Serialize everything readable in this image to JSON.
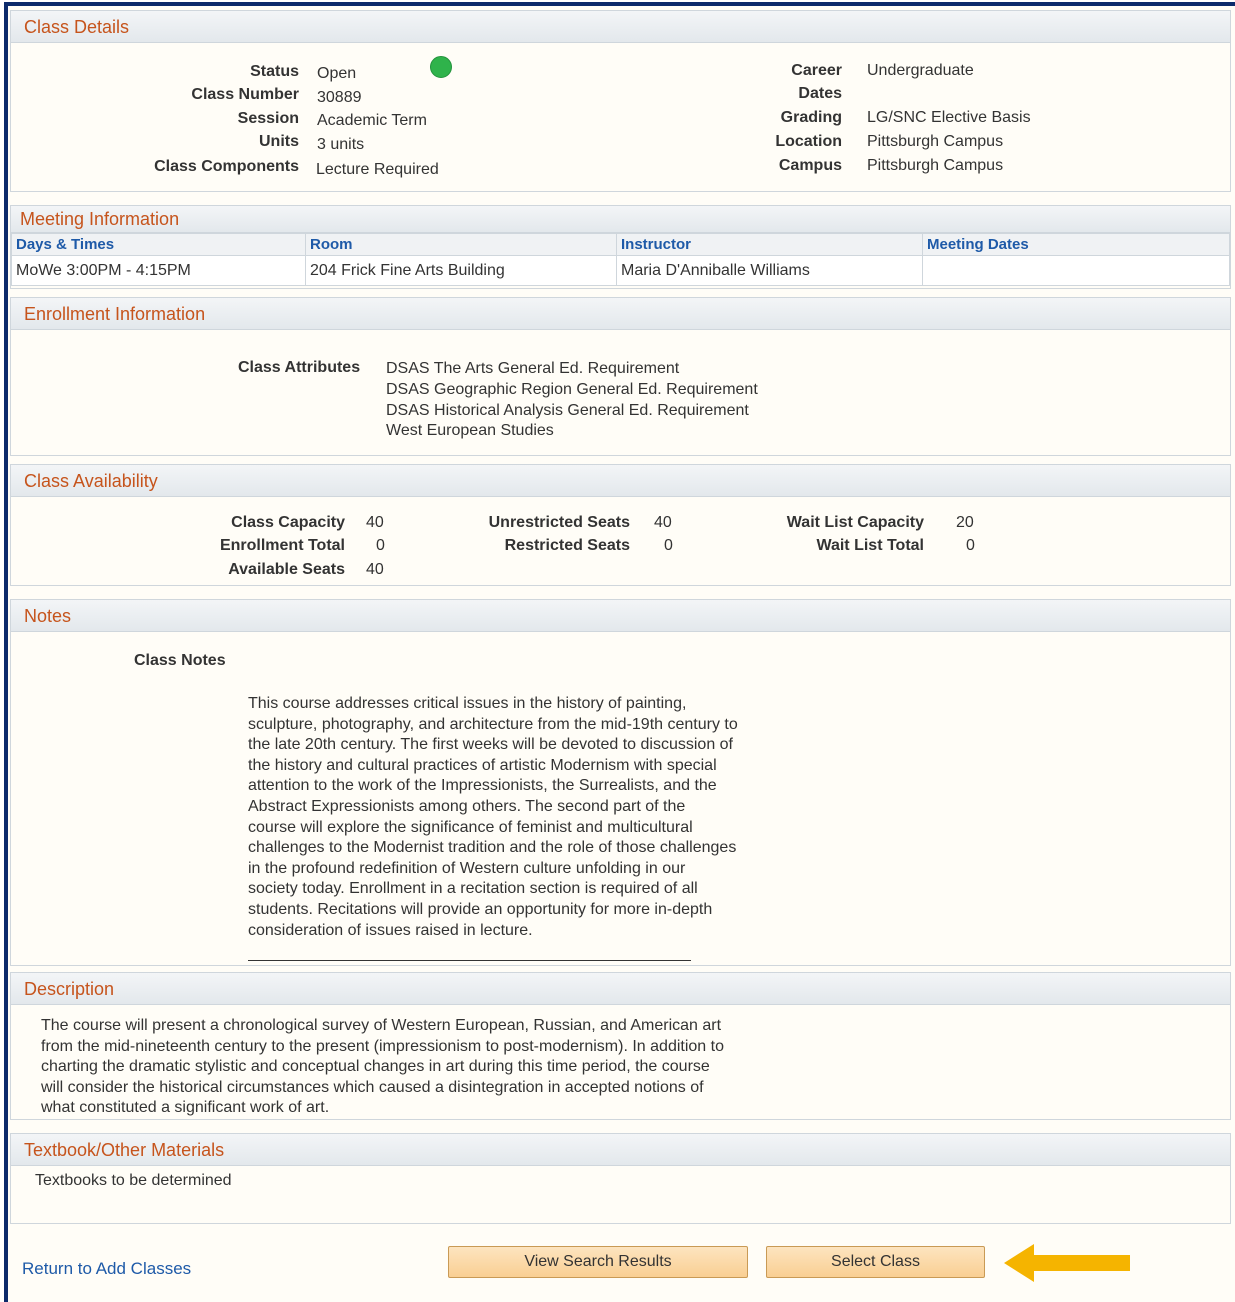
{
  "class_details": {
    "title": "Class Details",
    "left": [
      {
        "label": "Status",
        "value": "Open"
      },
      {
        "label": "Class Number",
        "value": "30889"
      },
      {
        "label": "Session",
        "value": "Academic Term"
      },
      {
        "label": "Units",
        "value": "3 units"
      },
      {
        "label": "Class Components",
        "value": "Lecture Required"
      }
    ],
    "right": [
      {
        "label": "Career",
        "value": "Undergraduate"
      },
      {
        "label": "Dates",
        "value": ""
      },
      {
        "label": "Grading",
        "value": "LG/SNC Elective Basis"
      },
      {
        "label": "Location",
        "value": "Pittsburgh Campus"
      },
      {
        "label": "Campus",
        "value": "Pittsburgh Campus"
      }
    ],
    "status_color": "#2fb34b"
  },
  "meeting": {
    "title": "Meeting Information",
    "headers": [
      "Days & Times",
      "Room",
      "Instructor",
      "Meeting Dates"
    ],
    "row": [
      "MoWe 3:00PM - 4:15PM",
      "204 Frick Fine Arts Building",
      "Maria D'Anniballe Williams",
      ""
    ]
  },
  "enrollment": {
    "title": "Enrollment Information",
    "attributes_label": "Class Attributes",
    "attributes": [
      "DSAS The Arts General Ed. Requirement",
      "DSAS Geographic Region General Ed. Requirement",
      "DSAS Historical Analysis General Ed. Requirement",
      "West European Studies"
    ]
  },
  "availability": {
    "title": "Class Availability",
    "col1": [
      {
        "label": "Class Capacity",
        "value": "40"
      },
      {
        "label": "Enrollment Total",
        "value": "0"
      },
      {
        "label": "Available Seats",
        "value": "40"
      }
    ],
    "col2": [
      {
        "label": "Unrestricted Seats",
        "value": "40"
      },
      {
        "label": "Restricted Seats",
        "value": "0"
      }
    ],
    "col3": [
      {
        "label": "Wait List Capacity",
        "value": "20"
      },
      {
        "label": "Wait List Total",
        "value": "0"
      }
    ]
  },
  "notes": {
    "title": "Notes",
    "label": "Class Notes",
    "lines": [
      "This course addresses critical issues in the history of painting,",
      "sculpture, photography, and architecture from the mid-19th century to",
      "the late 20th century.  The first weeks will be devoted to discussion of",
      "the history and cultural practices of artistic Modernism with special",
      "attention to the work of the Impressionists, the Surrealists, and the",
      "Abstract Expressionists among others.  The second part of the",
      "course will explore the significance of feminist and multicultural",
      "challenges to the Modernist tradition and the role of those challenges",
      "in the profound redefinition of Western culture unfolding in our",
      "society today.  Enrollment in a recitation section is required of all",
      "students.  Recitations will provide an opportunity for more in-depth",
      "consideration of issues raised in lecture."
    ]
  },
  "description": {
    "title": "Description",
    "lines": [
      "The course will present a chronological survey of Western European, Russian, and American art",
      "from the mid-nineteenth century to the present (impressionism to post-modernism). In addition to",
      "charting the dramatic stylistic and conceptual changes in art during this time period, the course",
      "will consider the historical circumstances which caused a disintegration in accepted notions of",
      "what constituted a significant work of art."
    ]
  },
  "textbook": {
    "title": "Textbook/Other Materials",
    "text": "Textbooks to be determined"
  },
  "footer": {
    "return_link": "Return to Add Classes",
    "view_results_button": "View Search Results",
    "select_class_button": "Select Class",
    "arrow_icon": "arrow-left-icon",
    "arrow_color": "#f5b400"
  }
}
